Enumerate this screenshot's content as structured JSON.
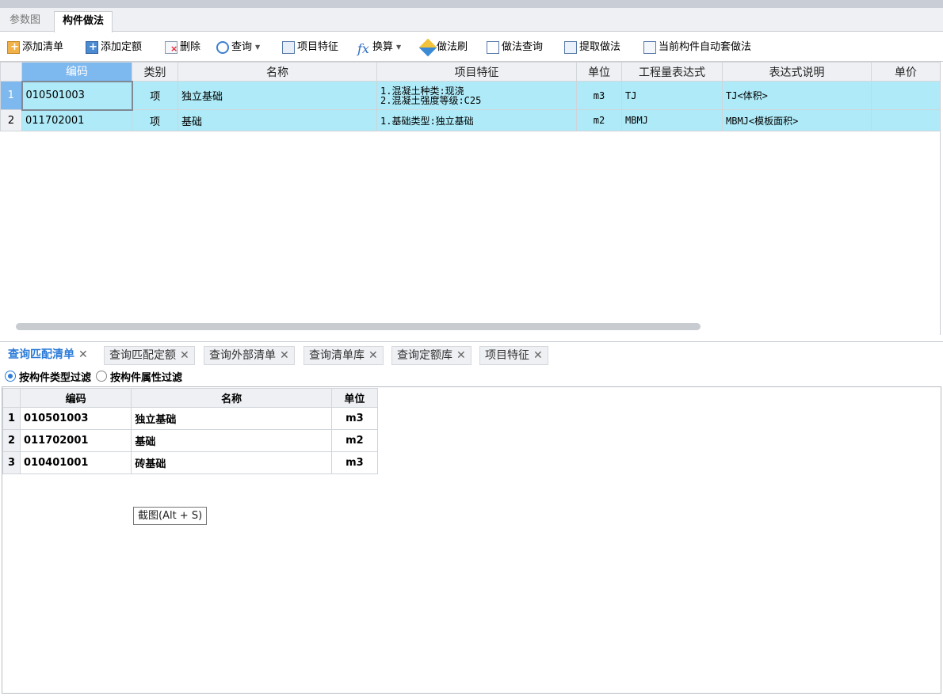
{
  "top_tabs": [
    {
      "label": "参数图",
      "active": false
    },
    {
      "label": "构件做法",
      "active": true
    }
  ],
  "toolbar": {
    "add_list": "添加清单",
    "add_quota": "添加定额",
    "delete": "删除",
    "query": "查询",
    "feature": "项目特征",
    "convert": "换算",
    "brush": "做法刷",
    "method_query": "做法查询",
    "extract": "提取做法",
    "auto_apply": "当前构件自动套做法"
  },
  "main_table": {
    "columns": [
      "编码",
      "类别",
      "名称",
      "项目特征",
      "单位",
      "工程量表达式",
      "表达式说明",
      "单价"
    ],
    "rows": [
      {
        "num": "1",
        "code": "010501003",
        "type": "项",
        "name": "独立基础",
        "feature_line1": "1.混凝土种类:现浇",
        "feature_line2": "2.混凝土强度等级:C25",
        "unit": "m3",
        "expr": "TJ",
        "expr_desc": "TJ<体积>",
        "price": ""
      },
      {
        "num": "2",
        "code": "011702001",
        "type": "项",
        "name": "基础",
        "feature_line1": "1.基础类型:独立基础",
        "unit": "m2",
        "expr": "MBMJ",
        "expr_desc": "MBMJ<模板面积>",
        "price": ""
      }
    ]
  },
  "bottom_tabs": [
    {
      "label": "查询匹配清单",
      "active": true
    },
    {
      "label": "查询匹配定额",
      "active": false
    },
    {
      "label": "查询外部清单",
      "active": false
    },
    {
      "label": "查询清单库",
      "active": false
    },
    {
      "label": "查询定额库",
      "active": false
    },
    {
      "label": "项目特征",
      "active": false
    }
  ],
  "filter": {
    "by_type": "按构件类型过滤",
    "by_attr": "按构件属性过滤",
    "selected": "by_type"
  },
  "match_table": {
    "columns": [
      "编码",
      "名称",
      "单位"
    ],
    "rows": [
      {
        "num": "1",
        "code": "010501003",
        "name": "独立基础",
        "unit": "m3"
      },
      {
        "num": "2",
        "code": "011702001",
        "name": "基础",
        "unit": "m2"
      },
      {
        "num": "3",
        "code": "010401001",
        "name": "砖基础",
        "unit": "m3"
      }
    ]
  },
  "tooltip": "截图(Alt + S)",
  "colors": {
    "selected_row": "#aeeaf7",
    "header_selected": "#7db8ef",
    "accent_tab": "#2b7bd8"
  }
}
